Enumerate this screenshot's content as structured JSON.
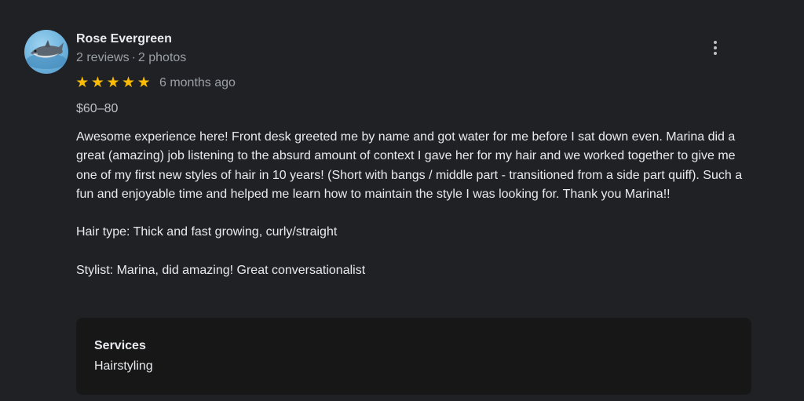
{
  "review": {
    "author": {
      "name": "Rose Evergreen",
      "reviews_count": "2 reviews",
      "separator": "·",
      "photos_count": "2 photos",
      "avatar_icon": "shark-avatar-icon"
    },
    "rating": {
      "stars": 5,
      "star_glyph": "★",
      "date": "6 months ago"
    },
    "price": "$60–80",
    "paragraphs": [
      "Awesome experience here! Front desk greeted me by name and got water for me before I sat down even. Marina did a great (amazing) job listening to the absurd amount of context I gave her for my hair and we worked together to give me one of my first new styles of hair in 10 years! (Short with bangs / middle part - transitioned from a side part quiff). Such a fun and enjoyable time and helped me learn how to maintain the style I was looking for. Thank you Marina!!",
      "Hair type: Thick and fast growing, curly/straight",
      "Stylist: Marina, did amazing! Great conversationalist"
    ],
    "services": {
      "title": "Services",
      "value": "Hairstyling"
    },
    "more_icon": "more-vertical-icon"
  },
  "colors": {
    "background": "#202124",
    "card": "#171717",
    "star": "#fbbc04",
    "secondary_text": "#9aa0a6",
    "primary_text": "#e8eaed"
  }
}
